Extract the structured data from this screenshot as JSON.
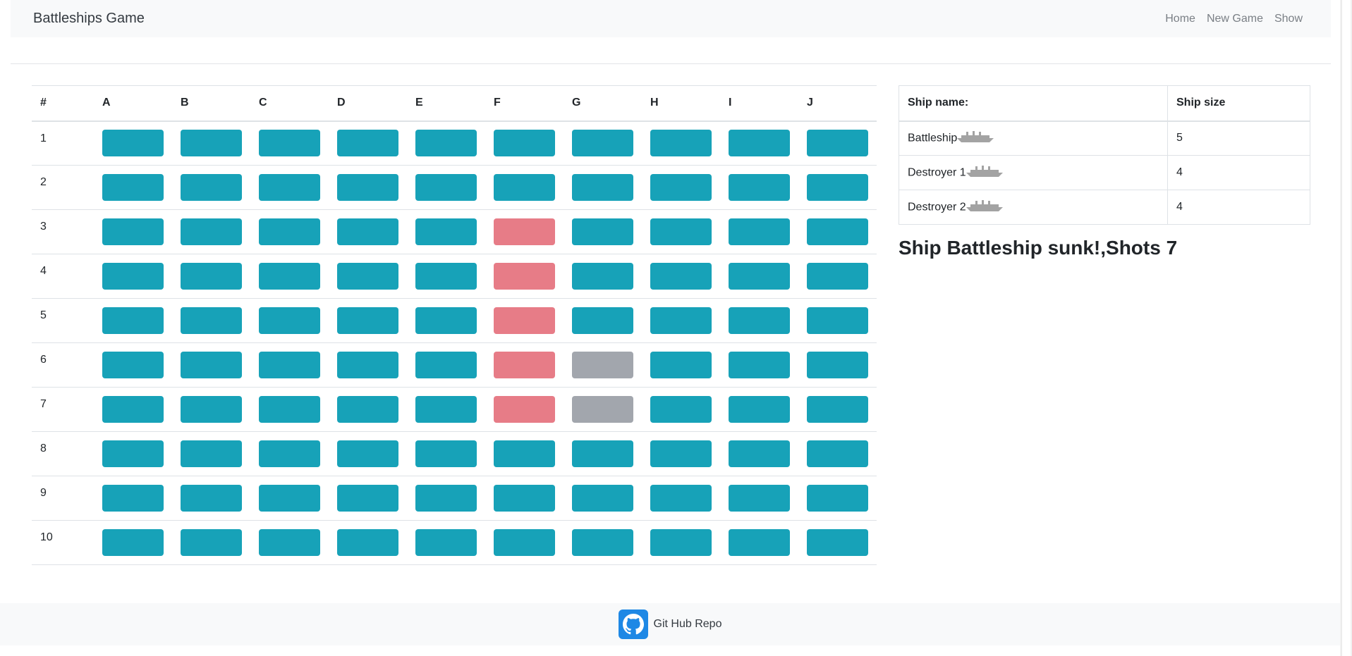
{
  "navbar": {
    "brand": "Battleships Game",
    "links": [
      "Home",
      "New Game",
      "Show"
    ]
  },
  "board": {
    "corner": "#",
    "columns": [
      "A",
      "B",
      "C",
      "D",
      "E",
      "F",
      "G",
      "H",
      "I",
      "J"
    ],
    "rows": [
      "1",
      "2",
      "3",
      "4",
      "5",
      "6",
      "7",
      "8",
      "9",
      "10"
    ],
    "cell_colors": {
      "unshot": "#17a2b8",
      "hit": "#e77c87",
      "miss": "#a2a6ad"
    },
    "hits": [
      "F3",
      "F4",
      "F5",
      "F6",
      "F7"
    ],
    "misses": [
      "G6",
      "G7"
    ]
  },
  "ships": {
    "headers": [
      "Ship name:",
      "Ship size"
    ],
    "rows": [
      {
        "name": "Battleship",
        "size": "5",
        "icon": "ship-icon"
      },
      {
        "name": "Destroyer 1",
        "size": "4",
        "icon": "ship-icon"
      },
      {
        "name": "Destroyer 2",
        "size": "4",
        "icon": "ship-icon"
      }
    ]
  },
  "status": "Ship Battleship sunk!,Shots 7",
  "footer": {
    "link": "Git Hub Repo",
    "icon": "github-icon"
  }
}
